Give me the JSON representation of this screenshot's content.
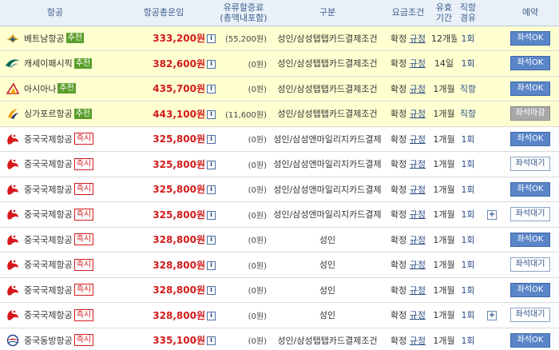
{
  "headers": {
    "airline": "항공",
    "fare": "항공총운임",
    "fuel_line1": "유류할증료",
    "fuel_line2": "(총액내포함)",
    "category": "구분",
    "condition": "요금조건",
    "validity_line1": "유효",
    "validity_line2": "기간",
    "route_line1": "직항",
    "route_line2": "경유",
    "booking": "예약"
  },
  "colors": {
    "header_bg": "#e9f0f8",
    "highlight_bg": "#ffffd2",
    "price": "#d31b1b",
    "recommend_tag": "#5a9e2a",
    "button_ok": "#5a85c8",
    "button_closed": "#a8a8a8"
  },
  "info_icon": "i",
  "rows": [
    {
      "airline": "베트남항공",
      "logo": "vietnam-airlines-logo",
      "tag": "추천",
      "tag_type": "rec",
      "highlight": true,
      "price": "333,200원",
      "fuel": "(55,200원)",
      "category": "성인/삼성탭탭카드결제조건",
      "status": "확정",
      "rule": "규정",
      "validity": "12개월",
      "route": "1회",
      "plus": false,
      "booking": "좌석OK",
      "booking_type": "ok"
    },
    {
      "airline": "캐세이패시픽",
      "logo": "cathay-pacific-logo",
      "tag": "추천",
      "tag_type": "rec",
      "highlight": true,
      "price": "382,600원",
      "fuel": "(0원)",
      "category": "성인/삼성탭탭카드결제조건",
      "status": "확정",
      "rule": "규정",
      "validity": "14일",
      "route": "1회",
      "plus": false,
      "booking": "좌석OK",
      "booking_type": "ok"
    },
    {
      "airline": "아시아나",
      "logo": "asiana-logo",
      "tag": "추천",
      "tag_type": "rec",
      "highlight": true,
      "price": "435,700원",
      "fuel": "(0원)",
      "category": "성인/삼성탭탭카드결제조건",
      "status": "확정",
      "rule": "규정",
      "validity": "1개월",
      "route": "직항",
      "plus": false,
      "booking": "좌석OK",
      "booking_type": "ok"
    },
    {
      "airline": "싱가포르항공",
      "logo": "singapore-airlines-logo",
      "tag": "추천",
      "tag_type": "rec",
      "highlight": true,
      "price": "443,100원",
      "fuel": "(11,600원)",
      "category": "성인/삼성탭탭카드결제조건",
      "status": "확정",
      "rule": "규정",
      "validity": "1개월",
      "route": "직항",
      "plus": false,
      "booking": "좌석마감",
      "booking_type": "close"
    },
    {
      "airline": "중국국제항공",
      "logo": "air-china-logo",
      "tag": "즉시",
      "tag_type": "now",
      "highlight": false,
      "price": "325,800원",
      "fuel": "(0원)",
      "category": "성인/삼성앤마일리지카드결제",
      "status": "확정",
      "rule": "규정",
      "validity": "1개월",
      "route": "1회",
      "plus": false,
      "booking": "좌석OK",
      "booking_type": "ok"
    },
    {
      "airline": "중국국제항공",
      "logo": "air-china-logo",
      "tag": "즉시",
      "tag_type": "now",
      "highlight": false,
      "price": "325,800원",
      "fuel": "(0원)",
      "category": "성인/삼성앤마일리지카드결제",
      "status": "확정",
      "rule": "규정",
      "validity": "1개월",
      "route": "1회",
      "plus": false,
      "booking": "좌석대기",
      "booking_type": "wait"
    },
    {
      "airline": "중국국제항공",
      "logo": "air-china-logo",
      "tag": "즉시",
      "tag_type": "now",
      "highlight": false,
      "price": "325,800원",
      "fuel": "(0원)",
      "category": "성인/삼성앤마일리지카드결제",
      "status": "확정",
      "rule": "규정",
      "validity": "1개월",
      "route": "1회",
      "plus": false,
      "booking": "좌석OK",
      "booking_type": "ok"
    },
    {
      "airline": "중국국제항공",
      "logo": "air-china-logo",
      "tag": "즉시",
      "tag_type": "now",
      "highlight": false,
      "price": "325,800원",
      "fuel": "(0원)",
      "category": "성인/삼성앤마일리지카드결제",
      "status": "확정",
      "rule": "규정",
      "validity": "1개월",
      "route": "1회",
      "plus": true,
      "booking": "좌석대기",
      "booking_type": "wait"
    },
    {
      "airline": "중국국제항공",
      "logo": "air-china-logo",
      "tag": "즉시",
      "tag_type": "now",
      "highlight": false,
      "price": "328,800원",
      "fuel": "(0원)",
      "category": "성인",
      "status": "확정",
      "rule": "규정",
      "validity": "1개월",
      "route": "1회",
      "plus": false,
      "booking": "좌석OK",
      "booking_type": "ok"
    },
    {
      "airline": "중국국제항공",
      "logo": "air-china-logo",
      "tag": "즉시",
      "tag_type": "now",
      "highlight": false,
      "price": "328,800원",
      "fuel": "(0원)",
      "category": "성인",
      "status": "확정",
      "rule": "규정",
      "validity": "1개월",
      "route": "1회",
      "plus": false,
      "booking": "좌석대기",
      "booking_type": "wait"
    },
    {
      "airline": "중국국제항공",
      "logo": "air-china-logo",
      "tag": "즉시",
      "tag_type": "now",
      "highlight": false,
      "price": "328,800원",
      "fuel": "(0원)",
      "category": "성인",
      "status": "확정",
      "rule": "규정",
      "validity": "1개월",
      "route": "1회",
      "plus": false,
      "booking": "좌석OK",
      "booking_type": "ok"
    },
    {
      "airline": "중국국제항공",
      "logo": "air-china-logo",
      "tag": "즉시",
      "tag_type": "now",
      "highlight": false,
      "price": "328,800원",
      "fuel": "(0원)",
      "category": "성인",
      "status": "확정",
      "rule": "규정",
      "validity": "1개월",
      "route": "1회",
      "plus": true,
      "booking": "좌석대기",
      "booking_type": "wait"
    },
    {
      "airline": "중국동방항공",
      "logo": "china-eastern-logo",
      "tag": "즉시",
      "tag_type": "now",
      "highlight": false,
      "price": "335,100원",
      "fuel": "(0원)",
      "category": "성인/삼성탭탭카드결제조건",
      "status": "확정",
      "rule": "규정",
      "validity": "1개월",
      "route": "1회",
      "plus": false,
      "booking": "좌석OK",
      "booking_type": "ok"
    }
  ]
}
